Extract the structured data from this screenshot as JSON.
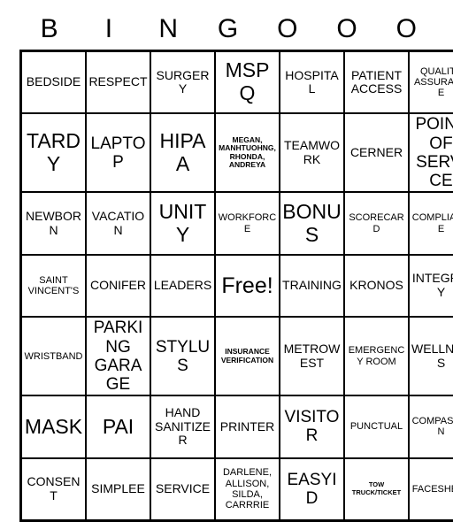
{
  "header": {
    "letters": [
      "B",
      "I",
      "N",
      "G",
      "O",
      "O",
      "O"
    ]
  },
  "grid": {
    "columns": 7,
    "rows": 7,
    "cells": [
      [
        {
          "text": "BEDSIDE",
          "size": "s-md"
        },
        {
          "text": "RESPECT",
          "size": "s-md"
        },
        {
          "text": "SURGERY",
          "size": "s-md"
        },
        {
          "text": "MSPQ",
          "size": "s-xl"
        },
        {
          "text": "HOSPITAL",
          "size": "s-md"
        },
        {
          "text": "PATIENT ACCESS",
          "size": "s-md"
        },
        {
          "text": "QUALITY ASSURANCE",
          "size": "s-sm"
        }
      ],
      [
        {
          "text": "TARDY",
          "size": "s-xl"
        },
        {
          "text": "LAPTOP",
          "size": "s-lg"
        },
        {
          "text": "HIPAA",
          "size": "s-xl"
        },
        {
          "text": "MEGAN, MANHTUOHNG, RHONDA, ANDREYA",
          "size": "s-xs"
        },
        {
          "text": "TEAMWORK",
          "size": "s-md"
        },
        {
          "text": "CERNER",
          "size": "s-md"
        },
        {
          "text": "POINT OF SERVICE",
          "size": "s-lg"
        }
      ],
      [
        {
          "text": "NEWBORN",
          "size": "s-md"
        },
        {
          "text": "VACATION",
          "size": "s-md"
        },
        {
          "text": "UNITY",
          "size": "s-xl"
        },
        {
          "text": "WORKFORCE",
          "size": "s-sm"
        },
        {
          "text": "BONUS",
          "size": "s-xl"
        },
        {
          "text": "SCORECARD",
          "size": "s-sm"
        },
        {
          "text": "COMPLIANCE",
          "size": "s-sm"
        }
      ],
      [
        {
          "text": "SAINT VINCENT'S",
          "size": "s-sm"
        },
        {
          "text": "CONIFER",
          "size": "s-md"
        },
        {
          "text": "LEADERS",
          "size": "s-md"
        },
        {
          "text": "Free!",
          "size": "free"
        },
        {
          "text": "TRAINING",
          "size": "s-md"
        },
        {
          "text": "KRONOS",
          "size": "s-md"
        },
        {
          "text": "INTEGRITY",
          "size": "s-md"
        }
      ],
      [
        {
          "text": "WRISTBAND",
          "size": "s-sm"
        },
        {
          "text": "PARKING GARAGE",
          "size": "s-lg"
        },
        {
          "text": "STYLUS",
          "size": "s-lg"
        },
        {
          "text": "INSURANCE VERIFICATION",
          "size": "s-xs"
        },
        {
          "text": "METROWEST",
          "size": "s-md"
        },
        {
          "text": "EMERGENCY ROOM",
          "size": "s-sm"
        },
        {
          "text": "WELLNESS",
          "size": "s-md"
        }
      ],
      [
        {
          "text": "MASK",
          "size": "s-xl"
        },
        {
          "text": "PAI",
          "size": "s-xl"
        },
        {
          "text": "HAND SANITIZER",
          "size": "s-md"
        },
        {
          "text": "PRINTER",
          "size": "s-md"
        },
        {
          "text": "VISITOR",
          "size": "s-lg"
        },
        {
          "text": "PUNCTUAL",
          "size": "s-sm"
        },
        {
          "text": "COMPASSION",
          "size": "s-sm"
        }
      ],
      [
        {
          "text": "CONSENT",
          "size": "s-md"
        },
        {
          "text": "SIMPLEE",
          "size": "s-md"
        },
        {
          "text": "SERVICE",
          "size": "s-md"
        },
        {
          "text": "DARLENE, ALLISON, SILDA, CARRRIE",
          "size": "s-sm"
        },
        {
          "text": "EASYID",
          "size": "s-lg"
        },
        {
          "text": "TOW TRUCK/TICKET",
          "size": "s-xxs"
        },
        {
          "text": "FACESHEET",
          "size": "s-sm"
        }
      ]
    ]
  }
}
